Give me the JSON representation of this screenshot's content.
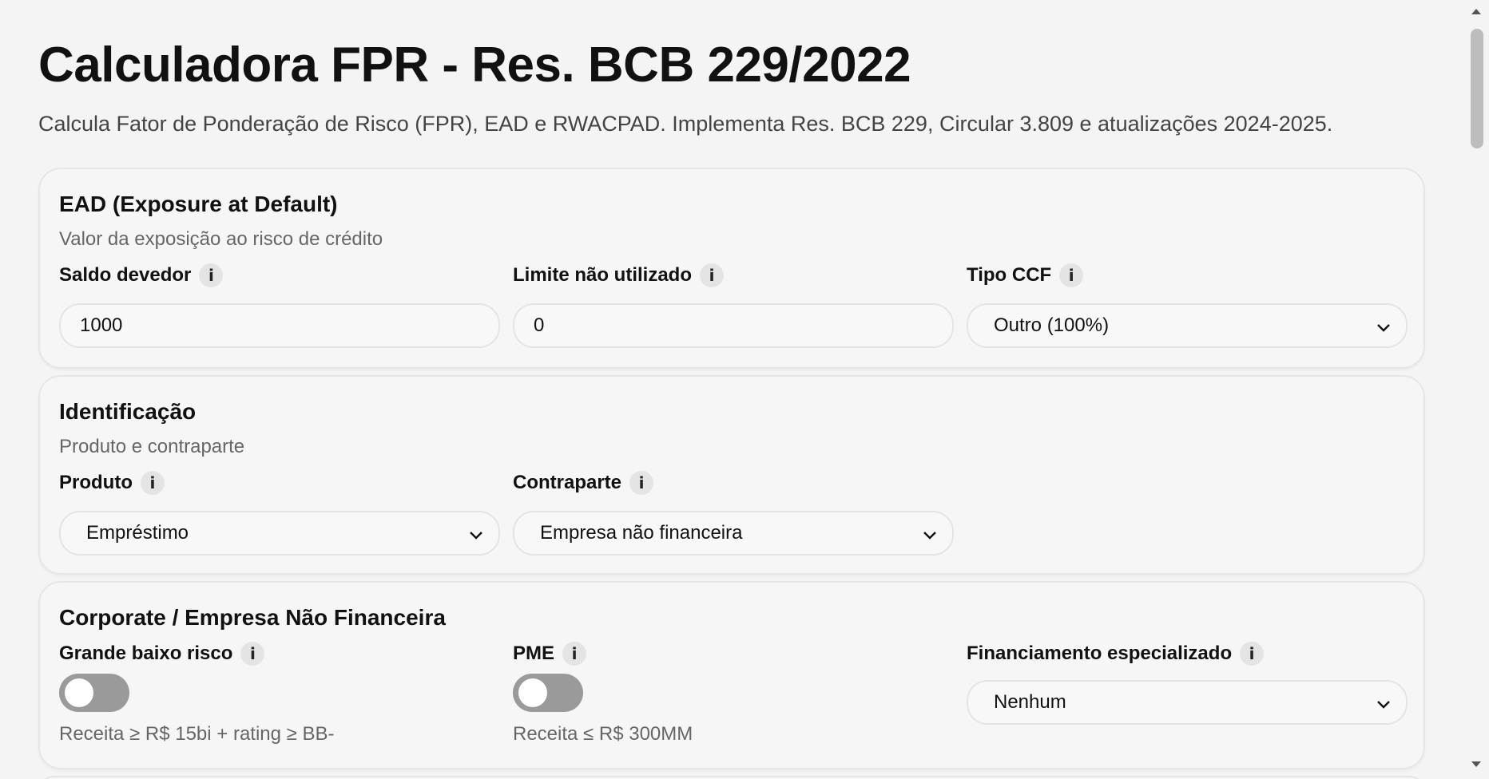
{
  "header": {
    "title": "Calculadora FPR - Res. BCB 229/2022",
    "subtitle": "Calcula Fator de Ponderação de Risco (FPR), EAD e RWACPAD. Implementa Res. BCB 229, Circular 3.809 e atualizações 2024-2025."
  },
  "ead": {
    "title": "EAD (Exposure at Default)",
    "description": "Valor da exposição ao risco de crédito",
    "saldo_label": "Saldo devedor",
    "saldo_value": "1000",
    "limite_label": "Limite não utilizado",
    "limite_value": "0",
    "ccf_label": "Tipo CCF",
    "ccf_value": "Outro (100%)"
  },
  "identificacao": {
    "title": "Identificação",
    "description": "Produto e contraparte",
    "produto_label": "Produto",
    "produto_value": "Empréstimo",
    "contraparte_label": "Contraparte",
    "contraparte_value": "Empresa não financeira"
  },
  "corporate": {
    "title": "Corporate / Empresa Não Financeira",
    "grande_label": "Grande baixo risco",
    "grande_hint": "Receita ≥ R$ 15bi + rating ≥ BB-",
    "grande_on": false,
    "pme_label": "PME",
    "pme_hint": "Receita ≤ R$ 300MM",
    "pme_on": false,
    "fin_label": "Financiamento especializado",
    "fin_value": "Nenhum"
  },
  "info_glyph": "i",
  "colors": {
    "background": "#f4f4f4",
    "card": "#f6f6f6",
    "toggle_off": "#9a9a9a"
  }
}
